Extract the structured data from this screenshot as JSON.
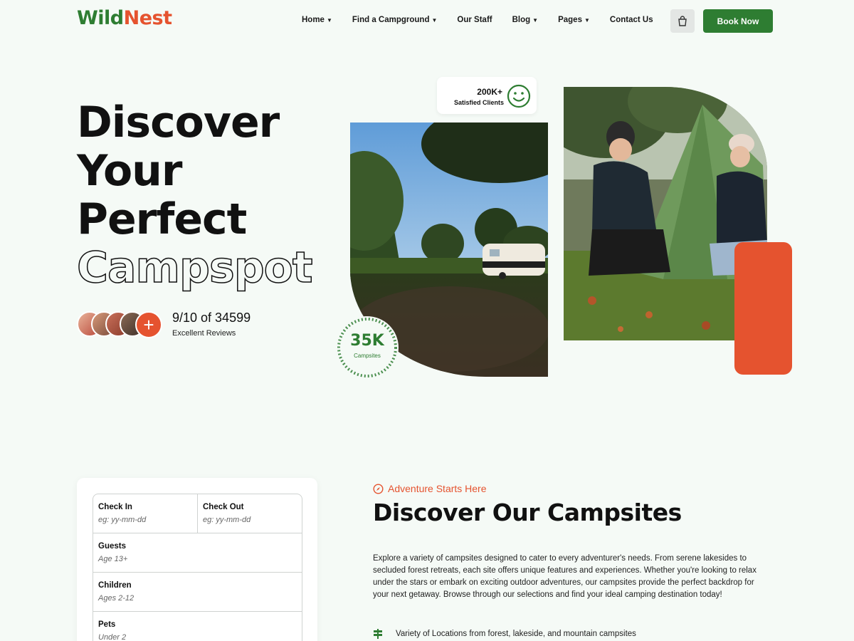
{
  "brand": {
    "part1": "Wild",
    "part2": "Nest"
  },
  "nav": [
    {
      "label": "Home",
      "dropdown": true
    },
    {
      "label": "Find a Campground",
      "dropdown": true
    },
    {
      "label": "Our Staff",
      "dropdown": false
    },
    {
      "label": "Blog",
      "dropdown": true
    },
    {
      "label": "Pages",
      "dropdown": true
    },
    {
      "label": "Contact Us",
      "dropdown": false
    }
  ],
  "header": {
    "cart_icon": "shopping-bag-icon",
    "book_label": "Book Now"
  },
  "hero": {
    "line1": "Discover",
    "line2": "Your",
    "line3": "Perfect",
    "line4": "Campspot",
    "reviews_value": "9/10 of 34599",
    "reviews_label": "Excellent Reviews"
  },
  "badges": {
    "clients_count": "200K+",
    "clients_label": "Satisfied Clients",
    "campsites_count": "35K",
    "campsites_label": "Campsites"
  },
  "booking": {
    "check_in_label": "Check In",
    "check_in_placeholder": "eg: yy-mm-dd",
    "check_out_label": "Check Out",
    "check_out_placeholder": "eg: yy-mm-dd",
    "guests_label": "Guests",
    "guests_placeholder": "Age 13+",
    "children_label": "Children",
    "children_placeholder": "Ages 2-12",
    "pets_label": "Pets",
    "pets_placeholder": "Under 2"
  },
  "campsites": {
    "eyebrow": "Adventure Starts Here",
    "title": "Discover Our Campsites",
    "body": "Explore a variety of campsites designed to cater to every adventurer's needs. From serene lakesides to secluded forest retreats, each site offers unique features and experiences. Whether you're looking to relax under the stars or embark on exciting outdoor adventures, our campsites provide the perfect backdrop for your next getaway. Browse through our selections and find your ideal camping destination today!",
    "feature1": "Variety of Locations from forest, lakeside, and mountain campsites"
  },
  "colors": {
    "green": "#2e7d32",
    "orange": "#e5532f",
    "background": "#f5faf6"
  }
}
